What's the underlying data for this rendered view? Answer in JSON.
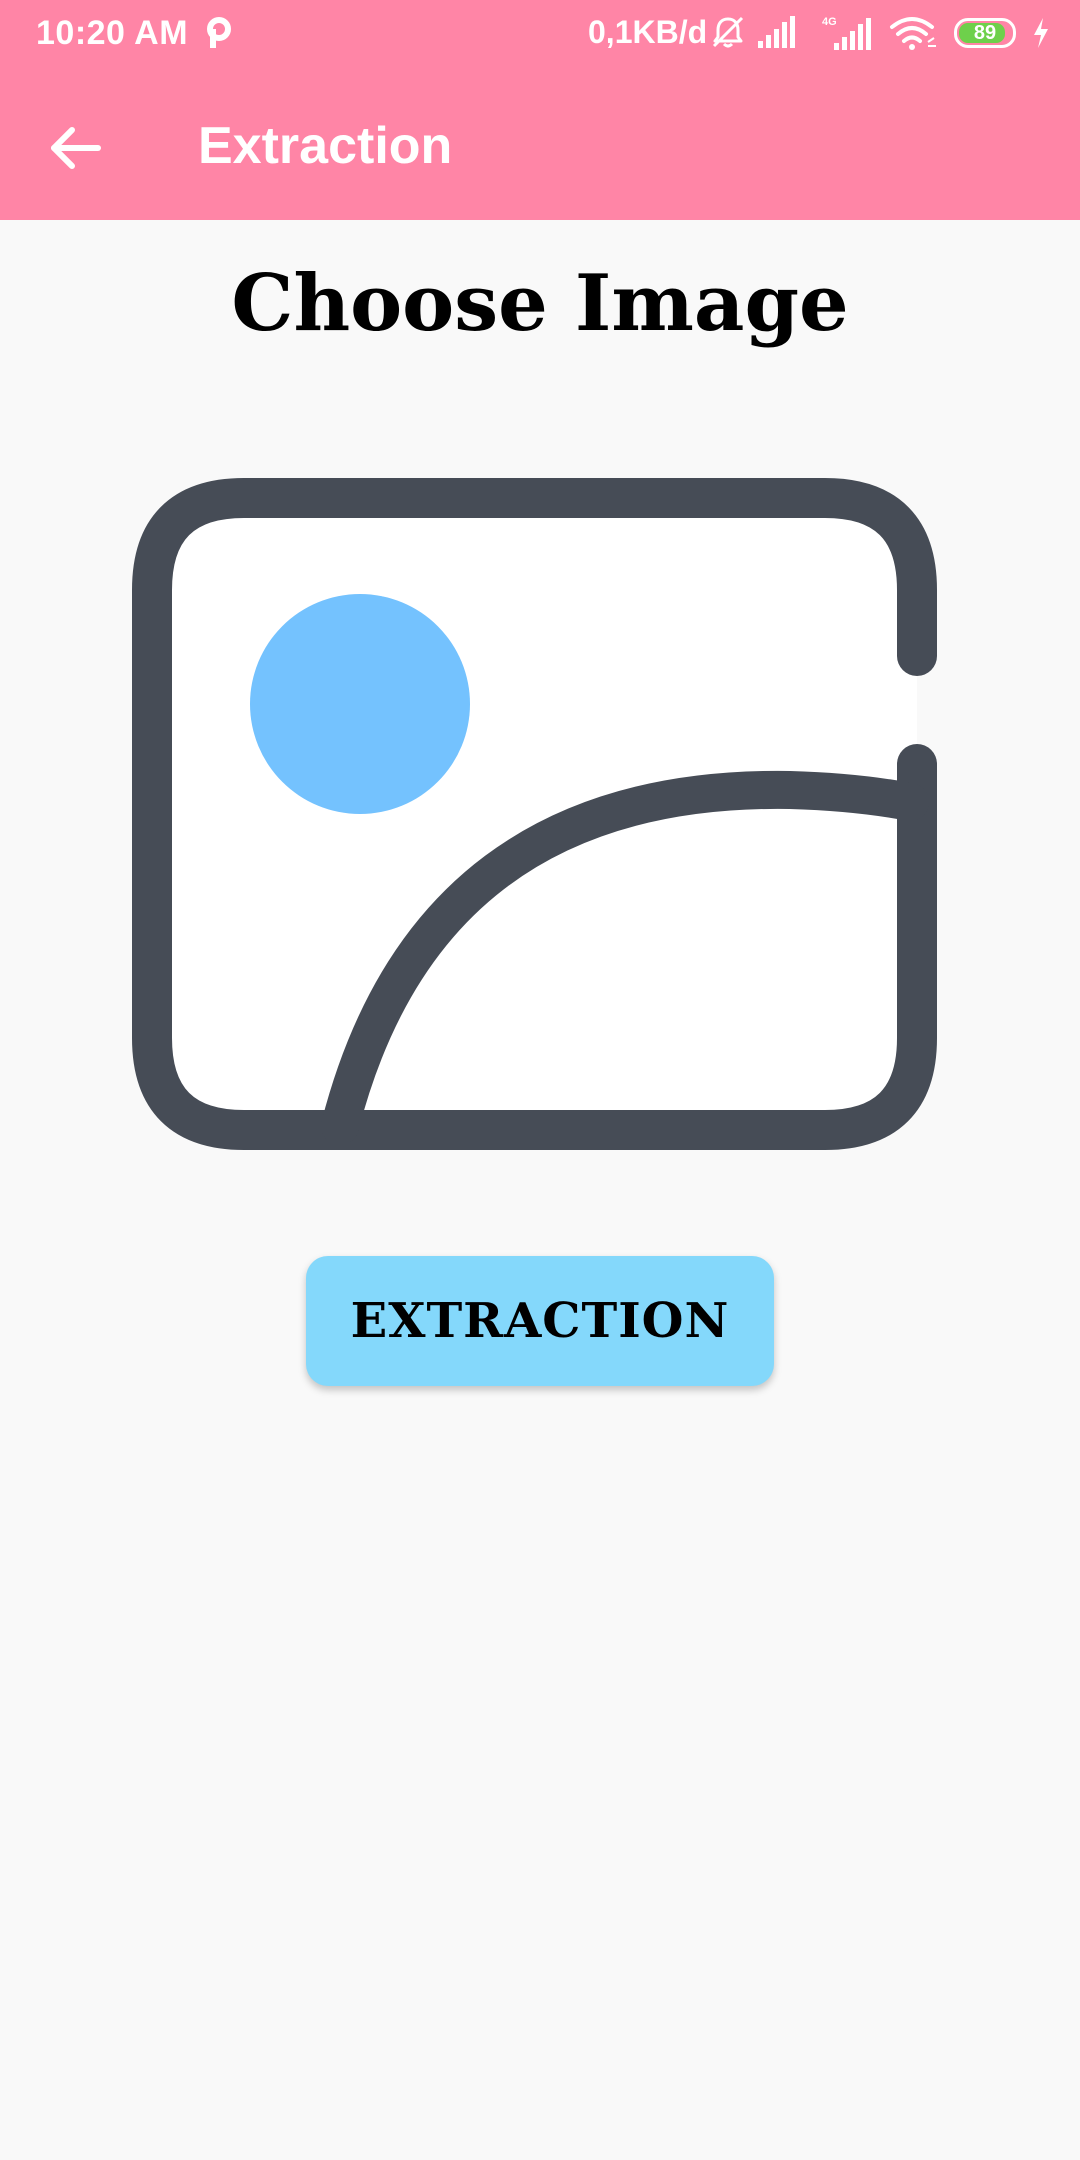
{
  "status_bar": {
    "time": "10:20 AM",
    "network_speed": "0,1KB/d",
    "network_type": "4G",
    "battery_level": "89",
    "battery_fraction": 0.89,
    "icons": [
      "parking-icon",
      "bell-muted-icon",
      "signal-icon",
      "signal-4g-icon",
      "wifi-icon",
      "battery-icon",
      "charging-icon"
    ]
  },
  "app_bar": {
    "title": "Extraction",
    "back_icon": "arrow-left-icon"
  },
  "main": {
    "heading": "Choose Image",
    "picker_icon": "image-placeholder-icon",
    "button_label": "EXTRACTION"
  },
  "colors": {
    "primary": "#ff85a6",
    "button": "#84d8fb",
    "background": "#f9f9f9",
    "icon_stroke": "#464c56",
    "sun": "#74c2fe"
  }
}
